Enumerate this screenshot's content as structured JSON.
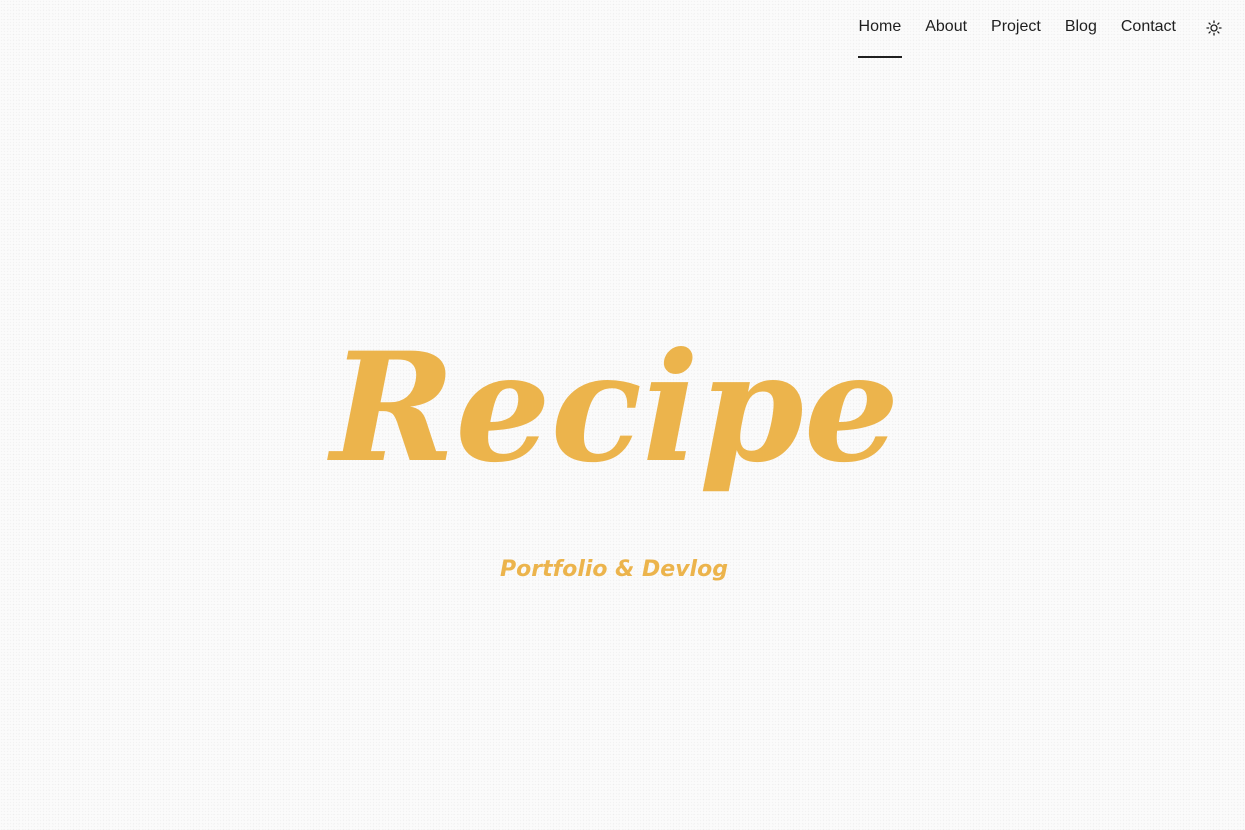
{
  "nav": {
    "items": [
      {
        "label": "Home",
        "active": true
      },
      {
        "label": "About",
        "active": false
      },
      {
        "label": "Project",
        "active": false
      },
      {
        "label": "Blog",
        "active": false
      },
      {
        "label": "Contact",
        "active": false
      }
    ],
    "theme_toggle_icon": "sun-icon"
  },
  "hero": {
    "title": "Recipe",
    "subtitle": "Portfolio & Devlog",
    "color": "#ecb44c"
  },
  "colors": {
    "background": "#fbfbfb",
    "text": "#1f1f1f",
    "accent": "#ecb44c"
  }
}
